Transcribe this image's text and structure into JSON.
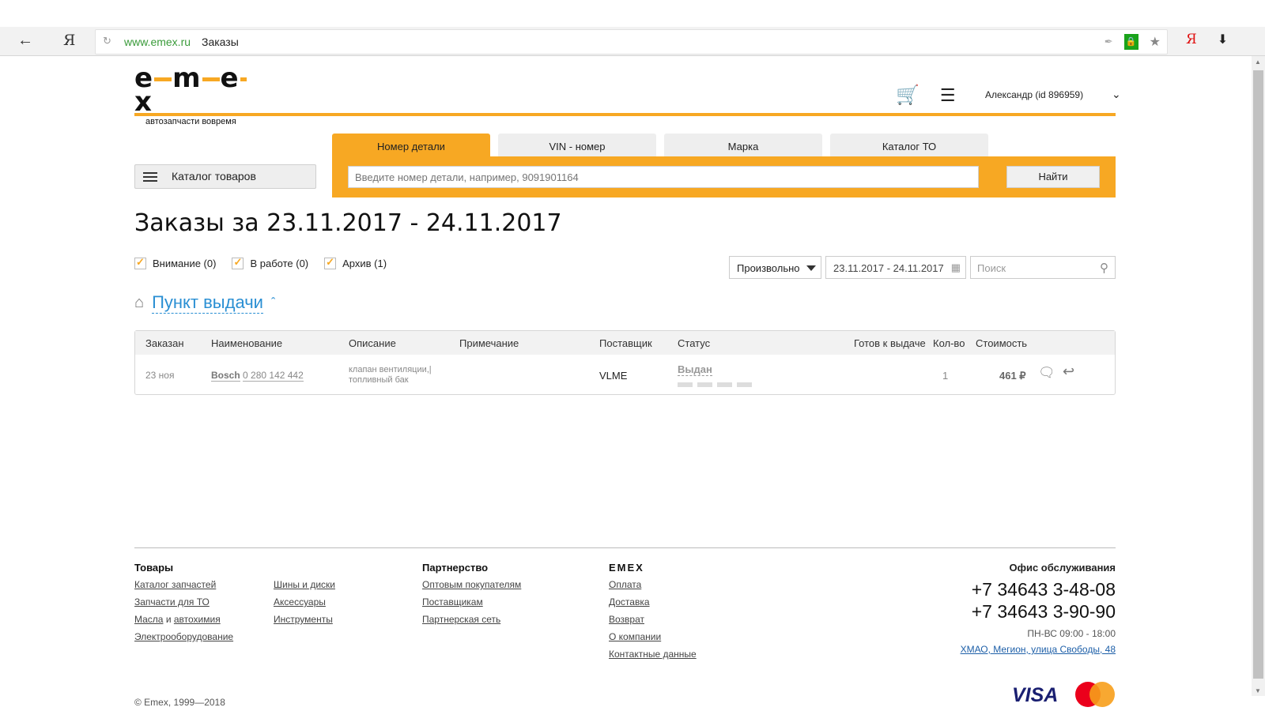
{
  "browser": {
    "url_host": "www.emex.ru",
    "page_title": "Заказы",
    "icons": [
      "back-icon",
      "yandex-icon",
      "reload-icon",
      "feather-icon",
      "lock-icon",
      "star-icon",
      "yandex-red-icon",
      "download-icon"
    ]
  },
  "header": {
    "logo_text": "EMEX",
    "logo_tagline": "автозапчасти вовремя",
    "user_name": "Александр",
    "user_id": "(id 896959)"
  },
  "catalog_button": {
    "label": "Каталог товаров"
  },
  "search": {
    "tabs": [
      {
        "label": "Номер детали",
        "active": true
      },
      {
        "label": "VIN - номер",
        "active": false
      },
      {
        "label": "Марка",
        "active": false
      },
      {
        "label": "Каталог ТО",
        "active": false
      }
    ],
    "placeholder": "Введите номер детали, например, 9091901164",
    "button_label": "Найти"
  },
  "page": {
    "title": "Заказы за 23.11.2017 - 24.11.2017",
    "filters": [
      {
        "label": "Внимание (0)",
        "checked": true
      },
      {
        "label": "В работе (0)",
        "checked": true
      },
      {
        "label": "Архив (1)",
        "checked": true
      }
    ],
    "range_select": "Произвольно",
    "date_range": "23.11.2017 - 24.11.2017",
    "search_placeholder": "Поиск",
    "pickup_label": "Пункт выдачи"
  },
  "orders_table": {
    "columns": [
      "Заказан",
      "Наименование",
      "Описание",
      "Примечание",
      "Поставщик",
      "Статус",
      "Готов к выдаче",
      "Кол-во",
      "Стоимость"
    ],
    "rows": [
      {
        "ordered": "23 ноя",
        "brand": "Bosch",
        "part_number": "0 280 142 442",
        "description_line1": "клапан вентиляции,",
        "description_line2": "топливный бак",
        "note": "",
        "supplier": "VLME",
        "status": "Выдан",
        "ready": "",
        "qty": "1",
        "price": "461 ₽"
      }
    ]
  },
  "footer": {
    "goods_head": "Товары",
    "goods_col1": [
      "Каталог запчастей",
      "Запчасти для ТО",
      "Масла",
      "Электрооборудование"
    ],
    "goods_and": "и",
    "goods_chem": "автохимия",
    "goods_col2": [
      "Шины и диски",
      "Аксессуары",
      "Инструменты"
    ],
    "partner_head": "Партнерство",
    "partner_links": [
      "Оптовым покупателям",
      "Поставщикам",
      "Партнерская сеть"
    ],
    "emex_head": "EMEX",
    "emex_links": [
      "Оплата",
      "Доставка",
      "Возврат",
      "О компании",
      "Контактные данные"
    ],
    "office_head": "Офис обслуживания",
    "phone1": "+7 34643 3-48-08",
    "phone2": "+7 34643 3-90-90",
    "hours": "ПН-ВС 09:00 - 18:00",
    "address": "ХМАО, Мегион, улица Свободы, 48",
    "copyright": "© Emex, 1999—2018",
    "visa": "VISA"
  },
  "colors": {
    "accent": "#f7a823",
    "link": "#2a8fd3"
  }
}
